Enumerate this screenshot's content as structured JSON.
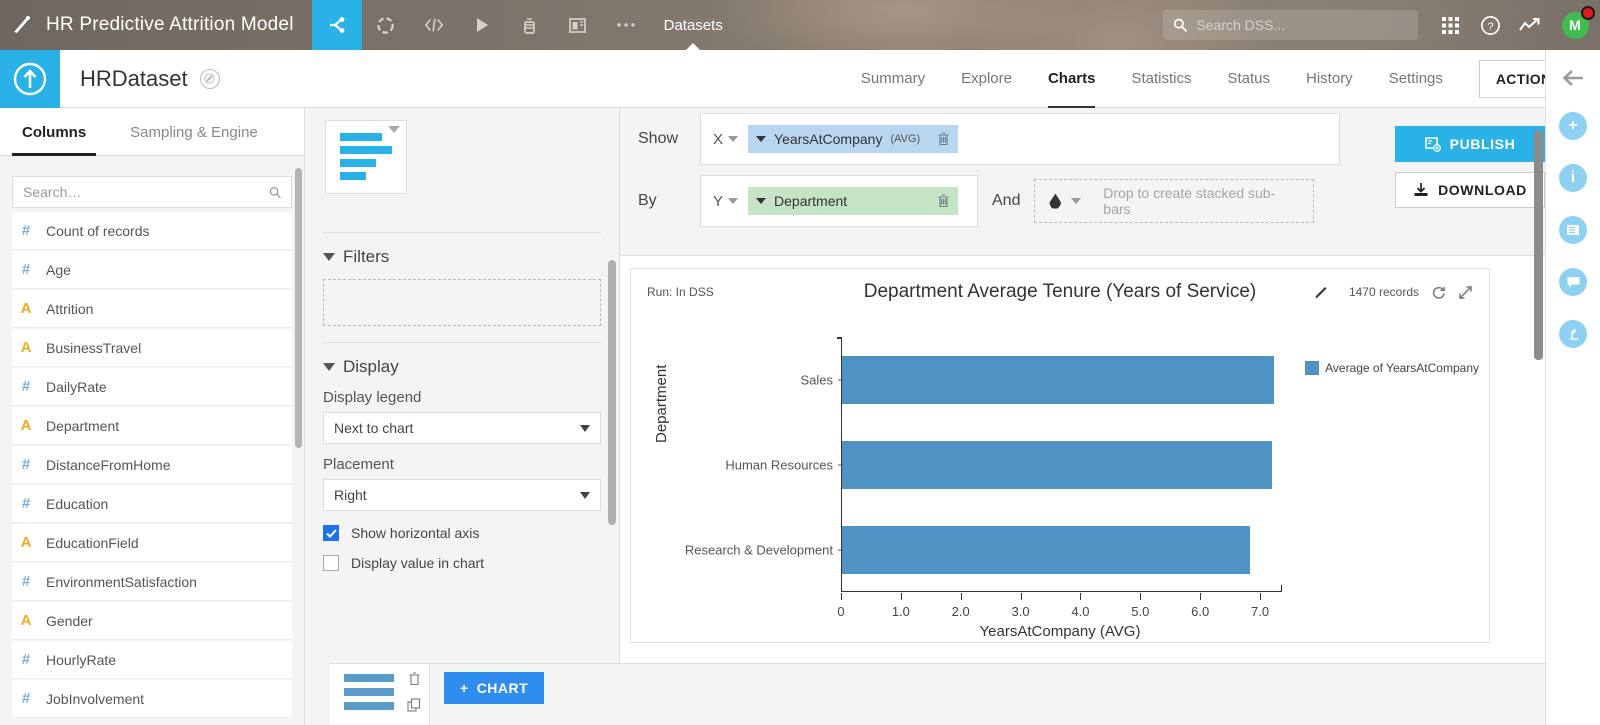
{
  "topbar": {
    "project_title": "HR Predictive Attrition Model",
    "active_section": "Datasets",
    "search_placeholder": "Search DSS...",
    "search_value": "",
    "avatar_initial": "M",
    "icons": [
      "flow-icon",
      "recipe-icon",
      "code-icon",
      "run-icon",
      "lab-icon",
      "dashboard-icon",
      "more-icon"
    ]
  },
  "subbar": {
    "dataset_name": "HRDataset",
    "tabs": [
      {
        "label": "Summary",
        "active": false
      },
      {
        "label": "Explore",
        "active": false
      },
      {
        "label": "Charts",
        "active": true
      },
      {
        "label": "Statistics",
        "active": false
      },
      {
        "label": "Status",
        "active": false
      },
      {
        "label": "History",
        "active": false
      },
      {
        "label": "Settings",
        "active": false
      }
    ],
    "actions_label": "ACTIONS"
  },
  "left_panel": {
    "tabs": [
      {
        "label": "Columns",
        "active": true
      },
      {
        "label": "Sampling & Engine",
        "active": false
      }
    ],
    "search_placeholder": "Search…",
    "search_value": "",
    "columns": [
      {
        "name": "Count of records",
        "type": "#"
      },
      {
        "name": "Age",
        "type": "#"
      },
      {
        "name": "Attrition",
        "type": "A"
      },
      {
        "name": "BusinessTravel",
        "type": "A"
      },
      {
        "name": "DailyRate",
        "type": "#"
      },
      {
        "name": "Department",
        "type": "A"
      },
      {
        "name": "DistanceFromHome",
        "type": "#"
      },
      {
        "name": "Education",
        "type": "#"
      },
      {
        "name": "EducationField",
        "type": "A"
      },
      {
        "name": "EnvironmentSatisfaction",
        "type": "#"
      },
      {
        "name": "Gender",
        "type": "A"
      },
      {
        "name": "HourlyRate",
        "type": "#"
      },
      {
        "name": "JobInvolvement",
        "type": "#"
      }
    ]
  },
  "mid_panel": {
    "filters_title": "Filters",
    "display_title": "Display",
    "display_legend_label": "Display legend",
    "display_legend_value": "Next to chart",
    "placement_label": "Placement",
    "placement_value": "Right",
    "show_horizontal_axis_label": "Show horizontal axis",
    "show_horizontal_axis_checked": true,
    "display_value_in_chart_label": "Display value in chart",
    "display_value_in_chart_checked": false
  },
  "config": {
    "show_label": "Show",
    "by_label": "By",
    "and_label": "And",
    "x_axis_selector": "X",
    "y_axis_selector": "Y",
    "x_measure": "YearsAtCompany",
    "x_measure_agg": "(AVG)",
    "y_dimension": "Department",
    "stacked_placeholder": "Drop to create stacked sub-bars",
    "publish_label": "PUBLISH",
    "download_label": "DOWNLOAD"
  },
  "chart_header": {
    "run_label": "Run: In DSS",
    "title": "Department Average Tenure (Years of Service)",
    "records": "1470 records"
  },
  "bottom": {
    "add_chart_label": "CHART",
    "add_chart_plus": "+"
  },
  "colors": {
    "accent": "#2ab1e8",
    "bar": "#4e93c4",
    "pill_measure": "#b8d6ef",
    "pill_dimension": "#c5e4c5",
    "publish_bg": "#2ab1e8",
    "add_chart_bg": "#2f8ded"
  },
  "chart_data": {
    "type": "bar",
    "orientation": "horizontal",
    "title": "Department Average Tenure (Years of Service)",
    "xlabel": "YearsAtCompany (AVG)",
    "ylabel": "Department",
    "categories": [
      "Sales",
      "Human Resources",
      "Research & Development"
    ],
    "values": [
      7.22,
      7.19,
      6.82
    ],
    "series": [
      {
        "name": "Average of YearsAtCompany",
        "values": [
          7.22,
          7.19,
          6.82
        ],
        "color": "#4e93c4"
      }
    ],
    "xlim": [
      0,
      7.35
    ],
    "xticks": [
      0,
      1.0,
      2.0,
      3.0,
      4.0,
      5.0,
      6.0,
      7.0
    ],
    "xtick_labels": [
      "0",
      "1.0",
      "2.0",
      "3.0",
      "4.0",
      "5.0",
      "6.0",
      "7.0"
    ],
    "grid": false,
    "legend": {
      "position": "right",
      "entries": [
        "Average of YearsAtCompany"
      ]
    },
    "records": 1470
  }
}
